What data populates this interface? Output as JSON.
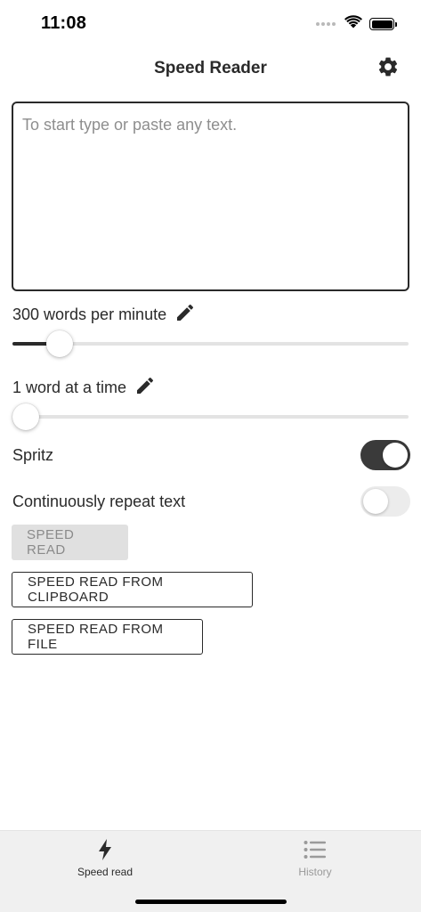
{
  "status_bar": {
    "time": "11:08"
  },
  "header": {
    "title": "Speed Reader",
    "settings_icon": "gear-icon"
  },
  "text_input": {
    "value": "",
    "placeholder": "To start type or paste any text."
  },
  "speed_setting": {
    "label": "300 words per minute",
    "value_wpm": 300,
    "slider_fraction": 0.12,
    "edit_icon": "pencil-icon"
  },
  "chunk_setting": {
    "label": "1 word at a time",
    "value_words": 1,
    "slider_fraction": 0.0,
    "edit_icon": "pencil-icon"
  },
  "toggles": {
    "spritz": {
      "label": "Spritz",
      "on": true
    },
    "repeat": {
      "label": "Continuously repeat text",
      "on": false
    }
  },
  "buttons": {
    "speed_read": "SPEED READ",
    "from_clipboard": "SPEED READ FROM CLIPBOARD",
    "from_file": "SPEED READ FROM FILE"
  },
  "bottom_nav": [
    {
      "label": "Speed read",
      "icon": "lightning-icon",
      "active": true
    },
    {
      "label": "History",
      "icon": "list-icon",
      "active": false
    }
  ],
  "colors": {
    "accent": "#2a2a2a",
    "toggle_on": "#3a3a3a",
    "toggle_off": "#ececec",
    "nav_bg": "#f0f0f0"
  }
}
